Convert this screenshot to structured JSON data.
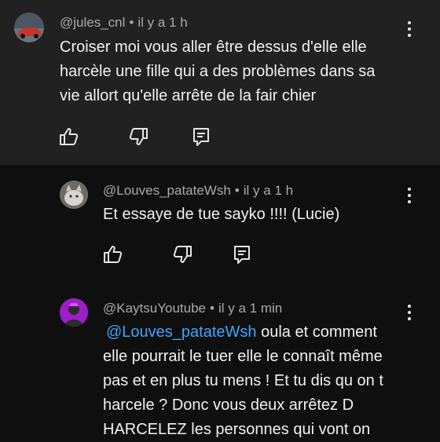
{
  "comments": [
    {
      "author": "@jules_cnl",
      "separator": "•",
      "time": "il y a 1 h",
      "lines": [
        "Croiser moi vous aller être dessus d'elle elle",
        "harcèle une fille qui a des problèmes dans sa",
        "vie allort qu'elle arrête de la fair chier"
      ],
      "icons": [
        "like-icon",
        "dislike-icon",
        "reply-icon",
        "more-vert-icon"
      ],
      "avatar_color": "#c0392b"
    },
    {
      "author": "@Louves_patateWsh",
      "separator": "•",
      "time": "il y a 1 h",
      "lines": [
        "Et essaye de tue sayko !!!! (Lucie)"
      ],
      "icons": [
        "like-icon",
        "dislike-icon",
        "reply-icon",
        "more-vert-icon"
      ],
      "avatar_color": "#8a8a8a"
    },
    {
      "author": "@KaytsuYoutube",
      "separator": "•",
      "time": "il y a 1 min",
      "mention": "@Louves_patateWsh",
      "lines": [
        " oula et comment",
        "elle pourrait le tuer elle le connaît même",
        "pas et en plus tu mens ! Et tu dis qu on t",
        "harcele ? Donc vous deux arrêtez D",
        "HARCELEZ les personnes qui vont on"
      ],
      "icons": [
        "more-vert-icon"
      ],
      "avatar_color": "#b02ad1"
    }
  ],
  "colors": {
    "background": "#0f0f0f",
    "highlight_background": "#212121",
    "text": "#f1f1f1",
    "meta_text": "#aaaaaa",
    "mention": "#3ea6ff"
  }
}
